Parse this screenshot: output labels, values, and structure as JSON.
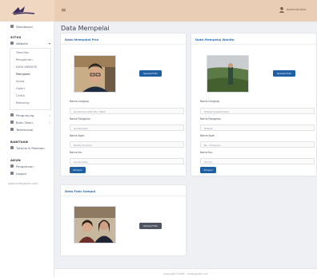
{
  "topbar": {
    "user_name": "Administrator"
  },
  "sidebar": {
    "dashboard": "Dashboard",
    "section_situs": "SITUS",
    "website": "Website",
    "submenu": [
      "Tampilan",
      "Pengaturan",
      "DATA WEBSITE",
      "Mempelai",
      "Acara",
      "Galeri",
      "Cerita",
      "Rekening"
    ],
    "submenu_active_index": 3,
    "pengunjung": "Pengunjung",
    "buku_tamu": "Buku Tamu",
    "testimonial": "Testimonial",
    "section_bantuan": "BANTUAN",
    "tutorial": "Tutorial & Panduan",
    "section_akun": "AKUN",
    "pengaturan": "Pengaturan",
    "logout": "Logout",
    "link": "www.undanganku.com/..."
  },
  "main": {
    "page_title": "Data Mempelai",
    "pria": {
      "title": "Data Mempelai Pria",
      "upload_label": "Upload Foto",
      "fields": [
        {
          "label": "Nama Lengkap",
          "value": "Guntarwan Adhi Nur Haleh"
        },
        {
          "label": "Nama Panggilan",
          "value": "Guntarwadi"
        },
        {
          "label": "Nama Ayah",
          "value": "Bapak Sumarjo"
        },
        {
          "label": "Nama Ibu",
          "value": "Ibu Sumarni"
        }
      ],
      "save_label": "Simpan"
    },
    "wanita": {
      "title": "Data Mempelai Wanita",
      "upload_label": "Upload Foto",
      "fields": [
        {
          "label": "Nama Lengkap",
          "value": "Wiwiek Swasta Dewi"
        },
        {
          "label": "Nama Panggilan",
          "value": "Wiwiek"
        },
        {
          "label": "Nama Ayah",
          "value": "Bp. Suharjono"
        },
        {
          "label": "Nama Ibu",
          "value": "Ibu Sri"
        }
      ],
      "save_label": "Simpan"
    },
    "sampul": {
      "title": "Data Foto Sampul",
      "upload_label": "Upload Foto"
    }
  },
  "footer": {
    "text": "Copyright ©2023 · Undanganku.com"
  },
  "colors": {
    "topbar": "#e9cdb5",
    "accent": "#1f5fa3",
    "card_title": "#2f6fb3"
  }
}
